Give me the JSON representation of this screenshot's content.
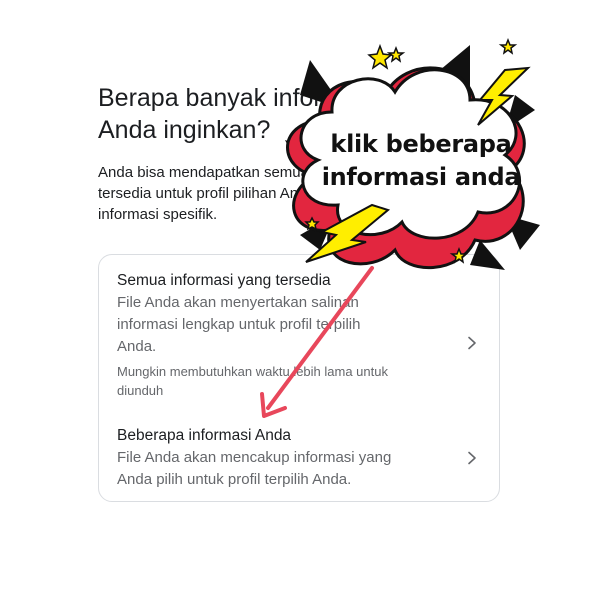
{
  "page": {
    "heading_lines": [
      "Berapa banyak informasi yang",
      "Anda inginkan?"
    ],
    "description_lines": [
      "Anda bisa mendapatkan semua informasi yang",
      "tersedia untuk profil pilihan Anda atau",
      "informasi spesifik."
    ]
  },
  "options": [
    {
      "title": "Semua informasi yang tersedia",
      "body_lines": [
        "File Anda akan menyertakan salinan",
        "informasi lengkap untuk profil terpilih",
        "Anda."
      ],
      "note_lines": [
        "Mungkin membutuhkan waktu lebih lama untuk",
        "diunduh"
      ],
      "icon": "chevron-right-icon"
    },
    {
      "title": "Beberapa informasi Anda",
      "body_lines": [
        "File Anda akan mencakup informasi yang",
        "Anda pilih untuk profil terpilih Anda."
      ],
      "icon": "chevron-right-icon"
    }
  ],
  "annotation": {
    "callout_lines": [
      "klik beberapa",
      "informasi anda"
    ],
    "arrow_color": "#e8475b",
    "cloud_shadow_color": "#e2263f",
    "bolt_color": "#ffee00",
    "star_color": "#ffe600"
  },
  "colors": {
    "text_primary": "#1c1e21",
    "text_secondary": "#65676b",
    "card_border": "#dadde1"
  }
}
